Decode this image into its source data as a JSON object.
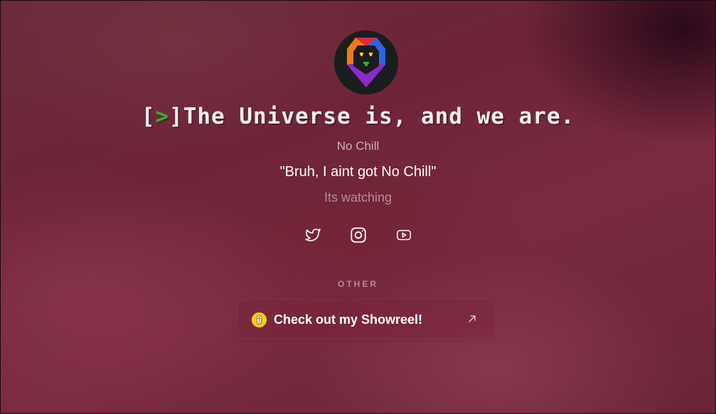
{
  "profile": {
    "avatar_icon": "lion-head-logo-icon",
    "title_bracket_open": "[",
    "title_arrow": ">",
    "title_bracket_close": "]",
    "title_text": "The Universe is, and we are.",
    "subtitle": "No Chill",
    "quote": "\"Bruh, I aint got No Chill\"",
    "tagline": "Its watching"
  },
  "socials": [
    {
      "icon": "twitter-icon"
    },
    {
      "icon": "instagram-icon"
    },
    {
      "icon": "youtube-icon"
    }
  ],
  "sections": {
    "other_label": "OTHER"
  },
  "links": [
    {
      "label": "Check out my Showreel!",
      "icon": "popcorn-icon",
      "arrow": "external-link-arrow-icon"
    }
  ],
  "colors": {
    "prompt_arrow": "#2fb52a",
    "card_icon": "#f4cf14",
    "avatar_bg": "#1a1d1e"
  }
}
